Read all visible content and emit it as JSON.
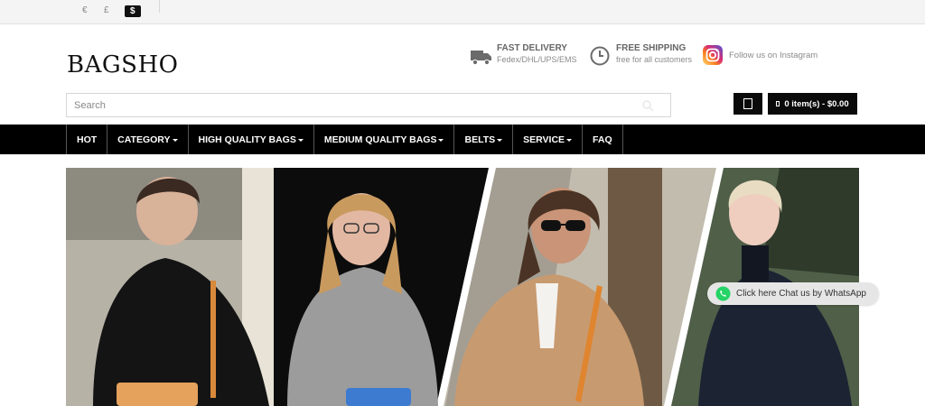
{
  "currency": {
    "options": [
      "€",
      "£",
      "$"
    ],
    "selected": "$"
  },
  "header": {
    "logo": "BAGSHO",
    "features": [
      {
        "icon": "truck-icon",
        "title": "FAST DELIVERY",
        "subtitle": "Fedex/DHL/UPS/EMS"
      },
      {
        "icon": "clock-icon",
        "title": "FREE SHIPPING",
        "subtitle": "free for all customers"
      }
    ],
    "social": {
      "icon": "instagram-icon",
      "text": "Follow us on Instagram"
    }
  },
  "search": {
    "placeholder": "Search",
    "value": ""
  },
  "cart": {
    "label": "0 item(s) - $0.00"
  },
  "nav": {
    "items": [
      {
        "label": "HOT",
        "dropdown": false
      },
      {
        "label": "CATEGORY",
        "dropdown": true
      },
      {
        "label": "HIGH QUALITY BAGS",
        "dropdown": true
      },
      {
        "label": "MEDIUM QUALITY BAGS",
        "dropdown": true
      },
      {
        "label": "BELTS",
        "dropdown": true
      },
      {
        "label": "SERVICE",
        "dropdown": true
      },
      {
        "label": "FAQ",
        "dropdown": false
      }
    ]
  },
  "whatsapp": {
    "label": "Click here Chat us by WhatsApp"
  },
  "colors": {
    "brand": "#000000",
    "whatsapp": "#25d366",
    "instagram": "#d62976"
  }
}
